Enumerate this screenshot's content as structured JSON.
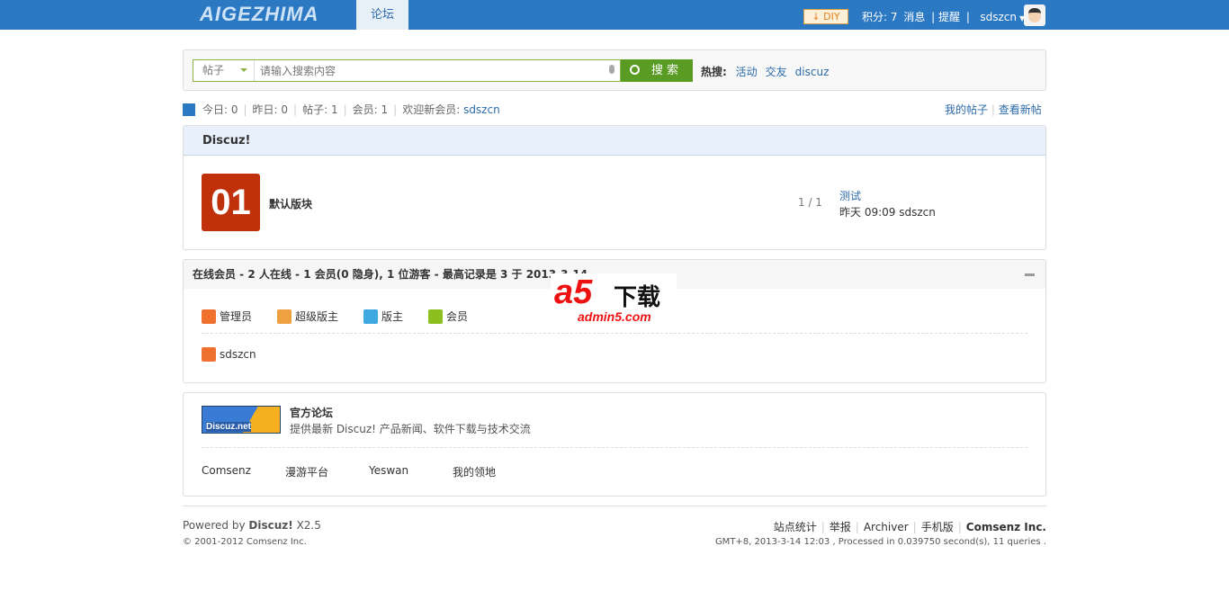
{
  "header": {
    "logo": "AIGEZHIMA",
    "nav_tab": "论坛",
    "diy": "DIY",
    "credits": "积分: 7",
    "messages": "消息",
    "alerts": "提醒",
    "username": "sdszcn"
  },
  "search": {
    "type": "帖子",
    "placeholder": "请输入搜索内容",
    "button": "搜 索",
    "hot_label": "热搜:",
    "hot": [
      "活动",
      "交友",
      "discuz"
    ]
  },
  "stats": {
    "today": "今日: 0",
    "yesterday": "昨日: 0",
    "posts": "帖子: 1",
    "members": "会员: 1",
    "newest": "欢迎新会员:",
    "newest_user": "sdszcn",
    "my_posts": "我的帖子",
    "new_posts": "查看新帖"
  },
  "category": {
    "title": "Discuz!",
    "forum": {
      "icon": "01",
      "name": "默认版块",
      "count": "1 / 1",
      "last_title": "测试",
      "last_info": "昨天 09:09 sdszcn"
    }
  },
  "online": {
    "title": "在线会员 - 2 人在线 - 1 会员(0 隐身), 1 位游客 - 最高记录是 3 于 2013-3-14",
    "legend": [
      "管理员",
      "超级版主",
      "版主",
      "会员"
    ],
    "legend_colors": [
      "#f07030",
      "#f0a040",
      "#40a8e0",
      "#8cc020"
    ],
    "users": [
      "sdszcn"
    ]
  },
  "watermark": {
    "brand": "a5",
    "text": "下载",
    "domain": "admin5.com"
  },
  "links": {
    "logo": "Discuz.net",
    "title": "官方论坛",
    "desc": "提供最新 Discuz! 产品新闻、软件下载与技术交流",
    "items": [
      "Comsenz",
      "漫游平台",
      "Yeswan",
      "我的领地"
    ]
  },
  "footer": {
    "powered": "Powered by",
    "product": "Discuz!",
    "version": "X2.5",
    "copyright": "© 2001-2012 Comsenz Inc.",
    "links": [
      "站点统计",
      "举报",
      "Archiver",
      "手机版"
    ],
    "company": "Comsenz Inc.",
    "gmt": "GMT+8, 2013-3-14 12:03 , Processed in 0.039750 second(s), 11 queries ."
  }
}
